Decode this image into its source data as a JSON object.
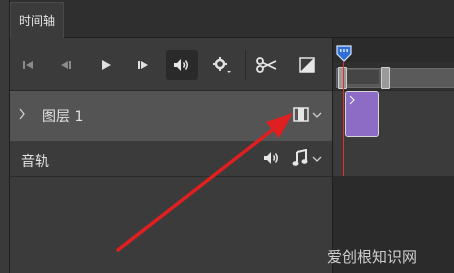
{
  "panel": {
    "tab_label": "时间轴"
  },
  "layers": [
    {
      "name": "图层 1"
    }
  ],
  "audio": {
    "label": "音轨"
  },
  "toolbar": {
    "buttons": [
      "go-to-first-frame-icon",
      "previous-frame-icon",
      "play-icon",
      "next-frame-icon",
      "audio-toggle-icon",
      "settings-icon",
      "split-scissors-icon",
      "transition-icon"
    ]
  },
  "colors": {
    "playhead": "#e03030",
    "clip": "#8c6cc4",
    "arrow": "#e02020"
  },
  "watermark": "爱创根知识网"
}
